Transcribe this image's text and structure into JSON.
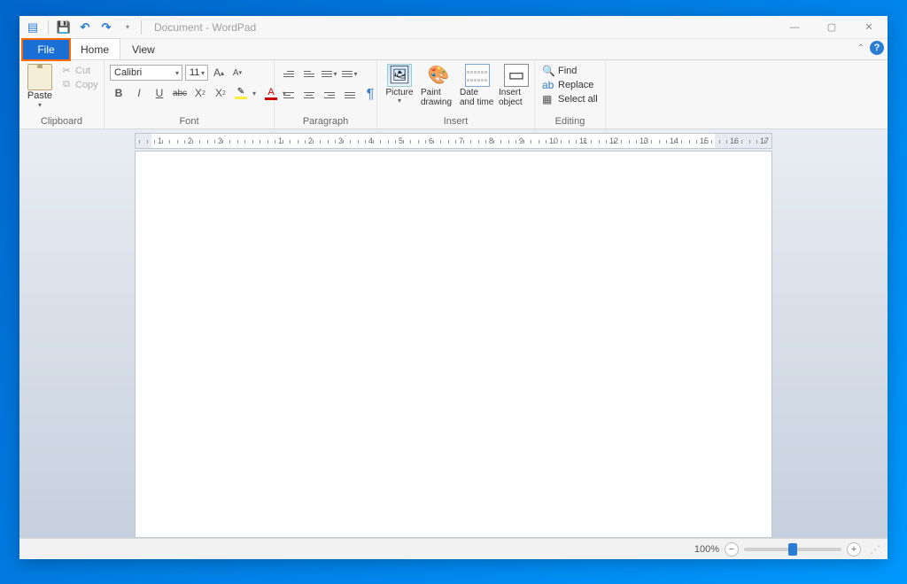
{
  "title": "Document - WordPad",
  "tabs": {
    "file": "File",
    "home": "Home",
    "view": "View"
  },
  "clipboard": {
    "paste": "Paste",
    "cut": "Cut",
    "copy": "Copy",
    "label": "Clipboard"
  },
  "font": {
    "family": "Calibri",
    "size": "11",
    "label": "Font"
  },
  "paragraph": {
    "label": "Paragraph"
  },
  "insert": {
    "picture": "Picture",
    "paint": "Paint drawing",
    "date": "Date and time",
    "object": "Insert object",
    "label": "Insert"
  },
  "editing": {
    "find": "Find",
    "replace": "Replace",
    "selectall": "Select all",
    "label": "Editing"
  },
  "ruler": {
    "left_labels": [
      "3",
      "2",
      "1"
    ],
    "right_labels": [
      "1",
      "2",
      "3",
      "4",
      "5",
      "6",
      "7",
      "8",
      "9",
      "10",
      "11",
      "12",
      "13",
      "14",
      "15",
      "16",
      "17"
    ]
  },
  "status": {
    "zoom": "100%"
  }
}
